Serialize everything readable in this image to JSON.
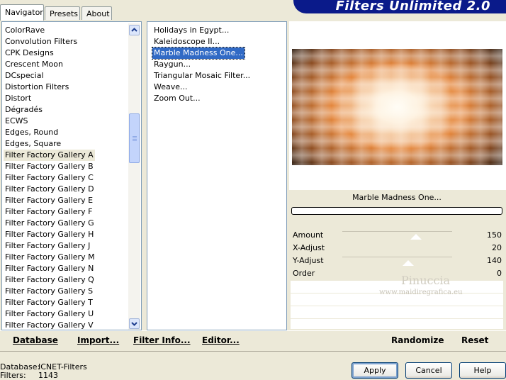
{
  "tabs": [
    "Navigator",
    "Presets",
    "About"
  ],
  "banner_title": "Filters Unlimited 2.0",
  "categories": [
    "ColorRave",
    "Convolution Filters",
    "CPK Designs",
    "Crescent Moon",
    "DCspecial",
    "Distortion Filters",
    "Distort",
    "Dégradés",
    "ECWS",
    "Edges, Round",
    "Edges, Square",
    "Filter Factory Gallery A",
    "Filter Factory Gallery B",
    "Filter Factory Gallery C",
    "Filter Factory Gallery D",
    "Filter Factory Gallery E",
    "Filter Factory Gallery F",
    "Filter Factory Gallery G",
    "Filter Factory Gallery H",
    "Filter Factory Gallery J",
    "Filter Factory Gallery M",
    "Filter Factory Gallery N",
    "Filter Factory Gallery Q",
    "Filter Factory Gallery S",
    "Filter Factory Gallery T",
    "Filter Factory Gallery U",
    "Filter Factory Gallery V"
  ],
  "selected_category": "Filter Factory Gallery A",
  "filters": [
    "Holidays in Egypt...",
    "Kaleidoscope II...",
    "Marble Madness One...",
    "Raygun...",
    "Triangular Mosaic Filter...",
    "Weave...",
    "Zoom Out..."
  ],
  "selected_filter": "Marble Madness One...",
  "preview_filter_name": "Marble Madness One...",
  "params": [
    {
      "label": "Amount",
      "value": "150"
    },
    {
      "label": "X-Adjust",
      "value": "20"
    },
    {
      "label": "Y-Adjust",
      "value": "140"
    },
    {
      "label": "Order",
      "value": "0"
    }
  ],
  "watermark": {
    "name": "Pinuccia",
    "site": "www.maidiregrafica.eu"
  },
  "toolbar": {
    "database": "Database",
    "import": "Import...",
    "filter_info": "Filter Info...",
    "editor": "Editor...",
    "randomize": "Randomize",
    "reset": "Reset"
  },
  "info": {
    "database_label": "Database:",
    "database_value": "ICNET-Filters",
    "filters_label": "Filters:",
    "filters_value": "1143"
  },
  "buttons": {
    "apply": "Apply",
    "cancel": "Cancel",
    "help": "Help"
  }
}
